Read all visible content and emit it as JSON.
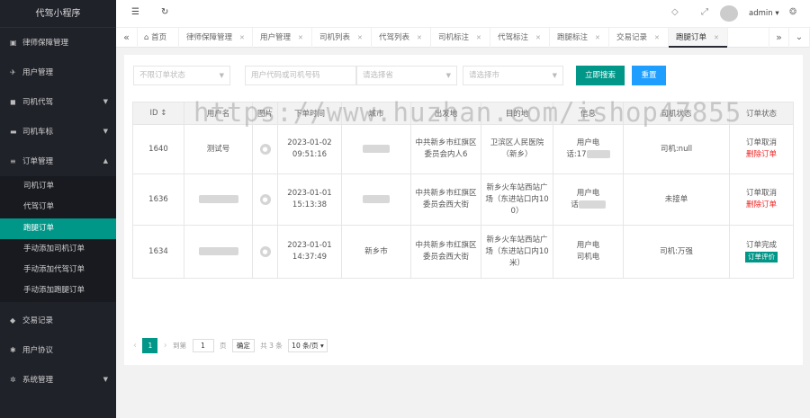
{
  "app": {
    "title": "代驾小程序"
  },
  "sidebar": {
    "items": [
      {
        "label": "律师保障管理",
        "icon": "image-icon"
      },
      {
        "label": "用户管理",
        "icon": "pin-icon"
      },
      {
        "label": "司机代驾",
        "icon": "car-icon",
        "arrow": "▼"
      },
      {
        "label": "司机车标",
        "icon": "car-side-icon",
        "arrow": "▼"
      },
      {
        "label": "订单管理",
        "icon": "list-icon",
        "arrow": "▲"
      }
    ],
    "sub_items": [
      "司机订单",
      "代驾订单",
      "跑腿订单",
      "手动添加司机订单",
      "手动添加代驾订单",
      "手动添加跑腿订单"
    ],
    "bottom_items": [
      {
        "label": "交易记录",
        "icon": "gem-icon"
      },
      {
        "label": "用户协议",
        "icon": "bug-icon"
      },
      {
        "label": "系统管理",
        "icon": "gear-icon",
        "arrow": "▼"
      }
    ]
  },
  "header": {
    "menu_icon": "☰",
    "refresh_icon": "↻",
    "tag_icon": "◇",
    "fullscreen_icon": "⤢",
    "user": "admin ▾",
    "theme_icon": "❂"
  },
  "tabs": {
    "prev": "«",
    "next": "»",
    "more": "⌄",
    "items": [
      {
        "label": "⌂ 首页"
      },
      {
        "label": "律师保障管理"
      },
      {
        "label": "用户管理"
      },
      {
        "label": "司机列表"
      },
      {
        "label": "代驾列表"
      },
      {
        "label": "司机标注"
      },
      {
        "label": "代驾标注"
      },
      {
        "label": "跑腿标注"
      },
      {
        "label": "交易记录"
      },
      {
        "label": "跑腿订单"
      }
    ],
    "close": "✕"
  },
  "filters": {
    "status_placeholder": "不限订单状态",
    "search_placeholder": "用户代码或司机号码",
    "province_placeholder": "请选择省",
    "city_placeholder": "请选择市",
    "search_button": "立即搜索",
    "reset_button": "重置"
  },
  "table": {
    "headers": [
      "ID ↕",
      "用户名",
      "图片",
      "下单时间",
      "城市",
      "出发地",
      "目的地",
      "信息",
      "司机状态",
      "订单状态"
    ],
    "rows": [
      {
        "id": "1640",
        "user": "测试号",
        "time1": "2023-01-02",
        "time2": "09:51:16",
        "city": "",
        "from": "中共新乡市红旗区委员会内人6",
        "to": "卫滨区人民医院（新乡）",
        "info1": "用户电",
        "info2": "话:17",
        "driver": "司机:null",
        "status1": "订单取消",
        "status2": "删除订单"
      },
      {
        "id": "1636",
        "user": "",
        "time1": "2023-01-01",
        "time2": "15:13:38",
        "city": "",
        "from": "中共新乡市红旗区委员会西大街",
        "to": "新乡火车站西站广场（东进站口内100）",
        "info1": "用户电",
        "info2": "话",
        "driver": "未接单",
        "status1": "订单取消",
        "status2": "删除订单"
      },
      {
        "id": "1634",
        "user": "",
        "time1": "2023-01-01",
        "time2": "14:37:49",
        "city": "新乡市",
        "from": "中共新乡市红旗区委员会西大街",
        "to": "新乡火车站西站广场（东进站口内10米）",
        "info1": "用户电",
        "info2": "司机电",
        "driver": "司机:万强",
        "status1": "订单完成",
        "status2": "订单评价"
      }
    ]
  },
  "pager": {
    "prev": "‹",
    "current": "1",
    "next": "›",
    "goto_label": "到第",
    "page_value": "1",
    "page_unit": "页",
    "confirm": "确定",
    "total": "共 3 条",
    "per_page": "10 条/页 ▾"
  },
  "watermark": "https://www.huzhan.com/ishop47855",
  "colors": {
    "sidebar": "#20222a",
    "accent": "#009688",
    "reset": "#1e9fff"
  }
}
